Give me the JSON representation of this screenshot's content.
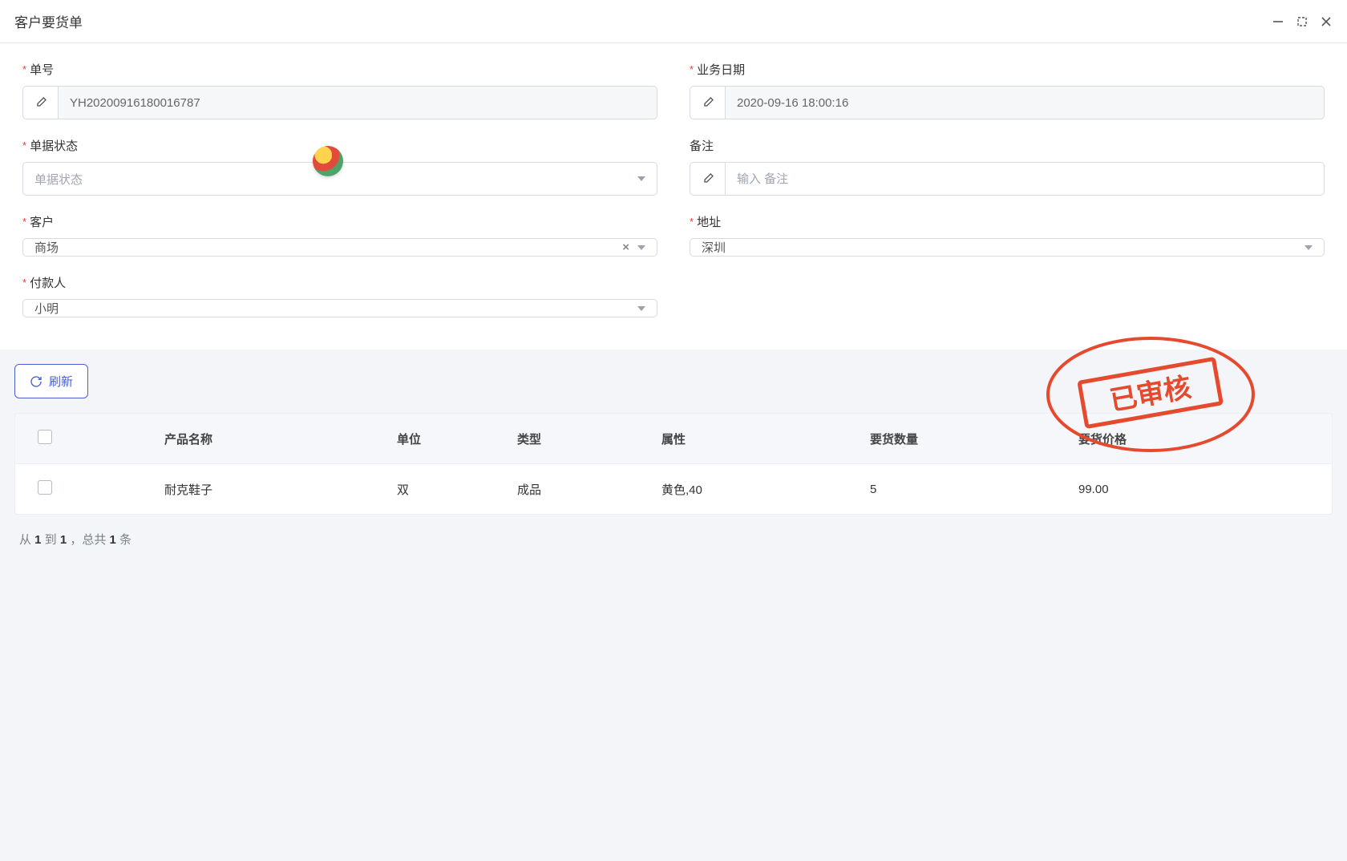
{
  "header": {
    "title": "客户要货单"
  },
  "form": {
    "order_no": {
      "label": "单号",
      "value": "YH20200916180016787"
    },
    "biz_date": {
      "label": "业务日期",
      "value": "2020-09-16 18:00:16"
    },
    "status": {
      "label": "单据状态",
      "placeholder": "单据状态",
      "value": ""
    },
    "remark": {
      "label": "备注",
      "placeholder": "输入 备注",
      "value": ""
    },
    "customer": {
      "label": "客户",
      "value": "商场"
    },
    "address": {
      "label": "地址",
      "value": "深圳"
    },
    "payer": {
      "label": "付款人",
      "value": "小明"
    }
  },
  "stamp_text": "已审核",
  "toolbar": {
    "refresh": "刷新"
  },
  "table": {
    "columns": {
      "name": "产品名称",
      "unit": "单位",
      "type": "类型",
      "attr": "属性",
      "qty": "要货数量",
      "price": "要货价格"
    },
    "rows": [
      {
        "name": "耐克鞋子",
        "unit": "双",
        "type": "成品",
        "attr": "黄色,40",
        "qty": "5",
        "price": "99.00"
      }
    ]
  },
  "pagination": {
    "from": "1",
    "to": "1",
    "total": "1",
    "tpl_prefix": "从 ",
    "tpl_mid1": " 到 ",
    "tpl_mid2": " ，总共 ",
    "tpl_suffix": " 条"
  }
}
